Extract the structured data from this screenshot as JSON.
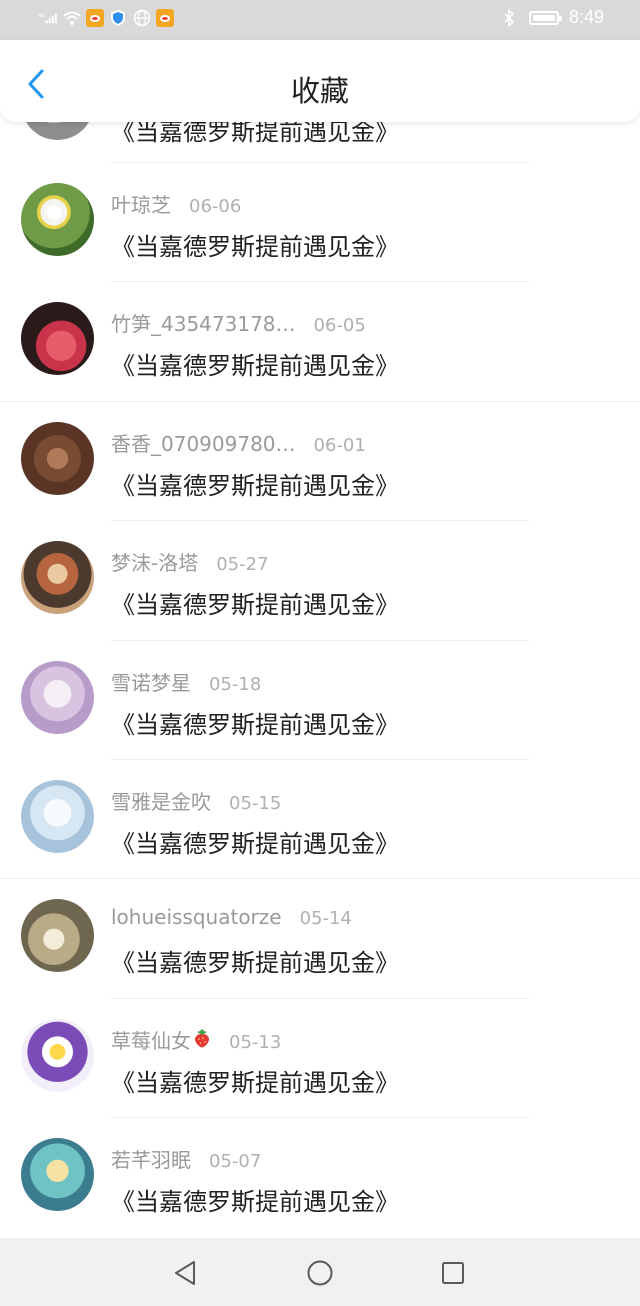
{
  "status_bar": {
    "network": "4G",
    "time": "8:49",
    "icons": [
      "signal-icon",
      "wifi-icon",
      "weibo-icon",
      "shield-icon",
      "globe-icon",
      "weibo-icon",
      "bluetooth-icon",
      "battery-icon"
    ]
  },
  "header": {
    "title": "收藏",
    "back_icon": "chevron-left-icon",
    "accent_color": "#2196f3"
  },
  "list": {
    "partial_top": {
      "title": "《当嘉德罗斯提前遇见金》"
    },
    "items": [
      {
        "username": "叶琼芝",
        "date": "06-06",
        "title": "《当嘉德罗斯提前遇见金》"
      },
      {
        "username": "竹笋_435473178…",
        "date": "06-05",
        "title": "《当嘉德罗斯提前遇见金》"
      },
      {
        "username": "香香_070909780…",
        "date": "06-01",
        "title": "《当嘉德罗斯提前遇见金》"
      },
      {
        "username": "梦沫-洛塔",
        "date": "05-27",
        "title": "《当嘉德罗斯提前遇见金》"
      },
      {
        "username": "雪诺梦星",
        "date": "05-18",
        "title": "《当嘉德罗斯提前遇见金》"
      },
      {
        "username": "雪雅是金吹",
        "date": "05-15",
        "title": "《当嘉德罗斯提前遇见金》"
      },
      {
        "username": "lohueissquatorze",
        "date": "05-14",
        "title": "《当嘉德罗斯提前遇见金》"
      },
      {
        "username": "草莓仙女",
        "date": "05-13",
        "title": "《当嘉德罗斯提前遇见金》"
      },
      {
        "username": "若芊羽眠",
        "date": "05-07",
        "title": "《当嘉德罗斯提前遇见金》"
      }
    ]
  },
  "nav_bar": {
    "back_icon": "triangle-back-icon",
    "home_icon": "circle-home-icon",
    "recents_icon": "square-recents-icon"
  }
}
